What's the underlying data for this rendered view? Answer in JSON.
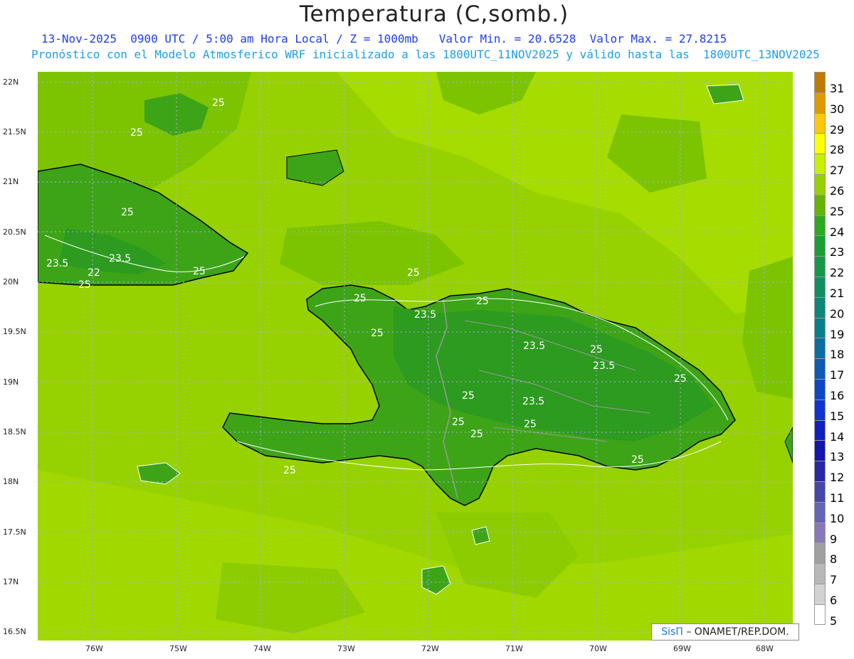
{
  "title": "Temperatura (C,somb.)",
  "subtitle_line1": "13-Nov-2025  0900 UTC / 5:00 am Hora Local / Z = 1000mb   Valor Min. = 20.6528  Valor Max. = 27.8215",
  "subtitle_line2": "Pronóstico con el Modelo Atmosferico WRF inicializado a las 1800UTC_11NOV2025 y válido hasta las  1800UTC_13NOV2025",
  "lat_labels": [
    "22N",
    "21.5N",
    "21N",
    "20.5N",
    "20N",
    "19.5N",
    "19N",
    "18.5N",
    "18N",
    "17.5N",
    "17N",
    "16.5N"
  ],
  "lon_labels": [
    "76W",
    "75W",
    "74W",
    "73W",
    "72W",
    "71W",
    "70W",
    "69W",
    "68W"
  ],
  "legend": {
    "values": [
      "31",
      "30",
      "29",
      "28",
      "27",
      "26",
      "25",
      "24",
      "23",
      "22",
      "21",
      "20",
      "19",
      "18",
      "17",
      "16",
      "15",
      "14",
      "13",
      "12",
      "11",
      "10",
      "9",
      "8",
      "7",
      "6",
      "5"
    ],
    "colors": [
      "#c07a00",
      "#e09a00",
      "#ffc800",
      "#ffff00",
      "#c8f000",
      "#96d200",
      "#64b400",
      "#2daa1e",
      "#19a032",
      "#149a46",
      "#109060",
      "#0a8878",
      "#08808c",
      "#0a6ea0",
      "#0c5ab4",
      "#0e46c8",
      "#1032d2",
      "#1020c0",
      "#1414b0",
      "#2828a8",
      "#4646b0",
      "#6464b8",
      "#8878b8",
      "#a0a0a0",
      "#b8b8b8",
      "#d2d2d2",
      "#ffffff"
    ]
  },
  "contour_labels": [
    "25",
    "25",
    "25",
    "23.5",
    "23.5",
    "22",
    "25",
    "25",
    "25",
    "25",
    "23.5",
    "25",
    "23.5",
    "25",
    "25",
    "23.5",
    "25",
    "25",
    "23.5",
    "25",
    "25",
    "25",
    "25",
    "25",
    "25"
  ],
  "credit": {
    "brand": "SisΠ",
    "text": "– ONAMET/REP.DOM."
  },
  "colors": {
    "sea": "#9ad400",
    "land_warm": "#7cc400",
    "land": "#3da418",
    "land_dark": "#2d9a20",
    "coast": "#000000",
    "border": "#9a9a9a"
  }
}
